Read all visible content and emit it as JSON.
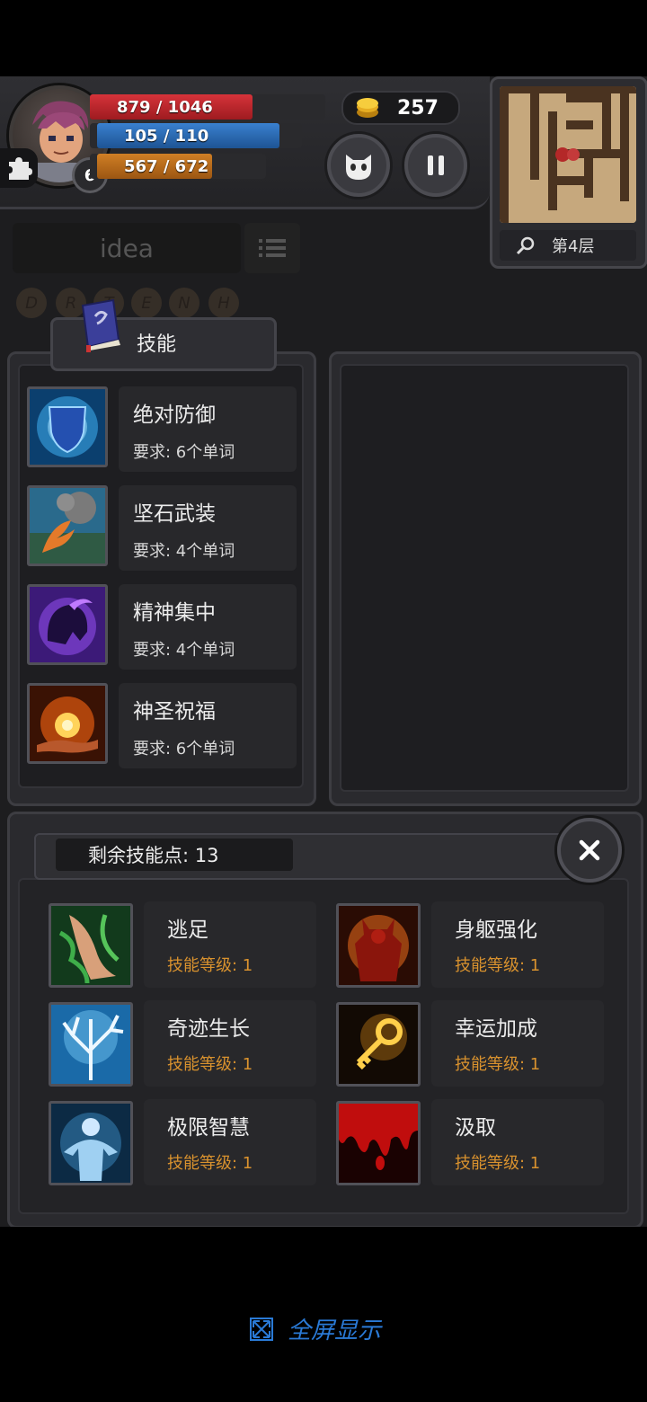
{
  "hud": {
    "level": "6",
    "hp_text": "879 / 1046",
    "hp_fraction": 0.84,
    "mp_text": "105 / 110",
    "mp_fraction": 0.95,
    "xp_text": "567 / 672",
    "xp_fraction": 0.84,
    "coins": "257",
    "floor": "第4层",
    "colors": {
      "hp": "#c0242b",
      "mp": "#2a6ab8",
      "xp": "#c26f19",
      "gold": "#e7b020"
    }
  },
  "word_input": {
    "text": "idea"
  },
  "runes": [
    "D",
    "R",
    "T",
    "E",
    "N",
    "H"
  ],
  "skills_tab": {
    "label": "技能"
  },
  "skills": [
    {
      "name": "绝对防御",
      "requirement": "要求: 6个单词",
      "icon": "shield-icon"
    },
    {
      "name": "坚石武装",
      "requirement": "要求: 4个单词",
      "icon": "stone-claw-icon"
    },
    {
      "name": "精神集中",
      "requirement": "要求: 4个单词",
      "icon": "helmet-icon"
    },
    {
      "name": "神圣祝福",
      "requirement": "要求: 6个单词",
      "icon": "holy-hand-icon"
    }
  ],
  "skill_points": {
    "label": "剩余技能点: 13"
  },
  "passives": [
    {
      "name": "逃足",
      "level": "技能等级: 1",
      "icon": "vine-foot-icon"
    },
    {
      "name": "身躯强化",
      "level": "技能等级: 1",
      "icon": "demon-body-icon"
    },
    {
      "name": "奇迹生长",
      "level": "技能等级: 1",
      "icon": "white-tree-icon"
    },
    {
      "name": "幸运加成",
      "level": "技能等级: 1",
      "icon": "golden-key-icon"
    },
    {
      "name": "极限智慧",
      "level": "技能等级: 1",
      "icon": "glowing-figure-icon"
    },
    {
      "name": "汲取",
      "level": "技能等级: 1",
      "icon": "blood-drip-icon"
    }
  ],
  "footer": {
    "fullscreen_label": "全屏显示"
  }
}
